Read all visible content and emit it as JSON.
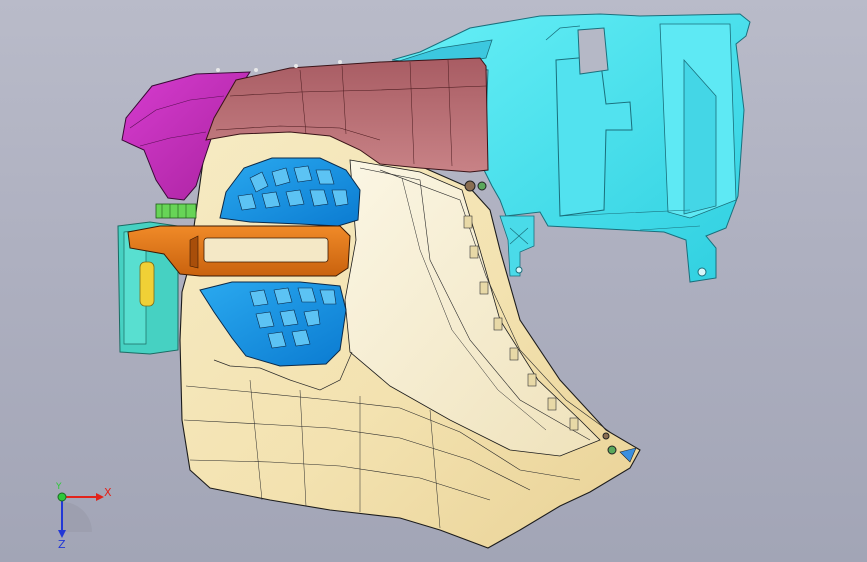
{
  "viewport": {
    "background_top": "#b9bbc9",
    "background_bottom": "#a2a5b6"
  },
  "model": {
    "parts": [
      {
        "name": "bumper-fascia",
        "color": "#f4e6b9"
      },
      {
        "name": "upper-bumper-trim",
        "color": "#b06a6e"
      },
      {
        "name": "fender-corner-piece",
        "color": "#c431bd"
      },
      {
        "name": "mounting-bracket",
        "color": "#52e7f2"
      },
      {
        "name": "upper-grille-insert",
        "color": "#1aa5ea"
      },
      {
        "name": "lower-grille-insert",
        "color": "#1aa5ea"
      },
      {
        "name": "fog-lamp-bezel",
        "color": "#e77a1d"
      },
      {
        "name": "side-marker-housing",
        "color": "#46d1c2"
      },
      {
        "name": "side-marker-reflector",
        "color": "#f0d036"
      },
      {
        "name": "clip-strip",
        "color": "#67d457"
      }
    ]
  },
  "triad": {
    "x_label": "X",
    "y_label": "Y",
    "z_label": "Z",
    "x_color": "#e2231a",
    "y_color": "#2ec83a",
    "z_color": "#2238d6"
  }
}
